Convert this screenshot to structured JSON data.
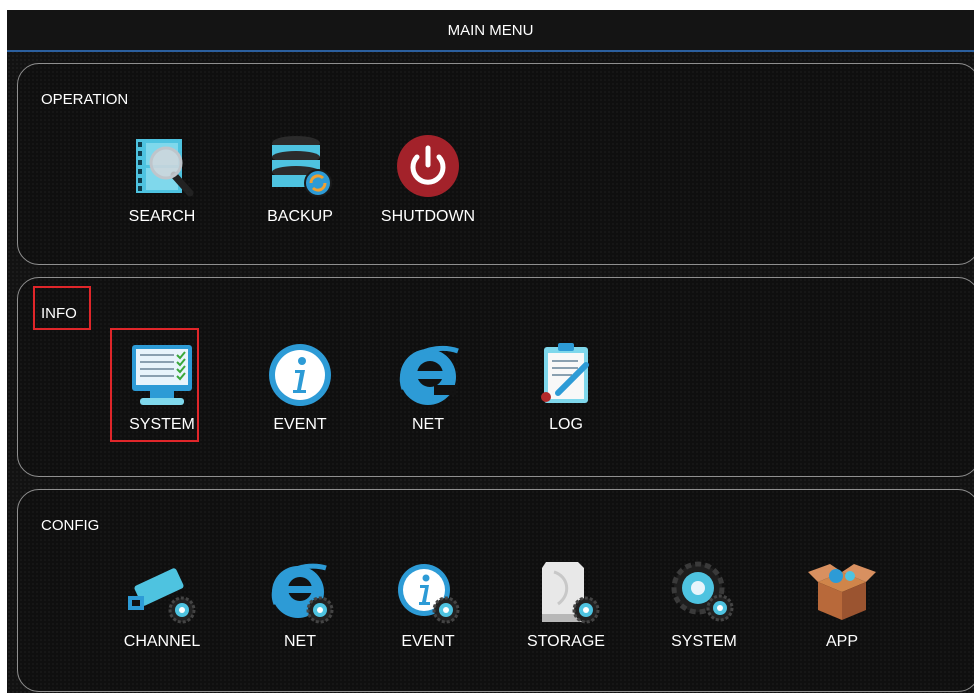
{
  "title": "MAIN MENU",
  "sections": {
    "operation": {
      "title": "OPERATION",
      "items": [
        {
          "label": "SEARCH",
          "icon": "search-icon"
        },
        {
          "label": "BACKUP",
          "icon": "backup-icon"
        },
        {
          "label": "SHUTDOWN",
          "icon": "power-icon"
        }
      ]
    },
    "info": {
      "title": "INFO",
      "items": [
        {
          "label": "SYSTEM",
          "icon": "monitor-checklist-icon"
        },
        {
          "label": "EVENT",
          "icon": "info-icon"
        },
        {
          "label": "NET",
          "icon": "internet-e-icon"
        },
        {
          "label": "LOG",
          "icon": "clipboard-log-icon"
        }
      ]
    },
    "config": {
      "title": "CONFIG",
      "items": [
        {
          "label": "CHANNEL",
          "icon": "camera-gear-icon"
        },
        {
          "label": "NET",
          "icon": "internet-e-gear-icon"
        },
        {
          "label": "EVENT",
          "icon": "info-gear-icon"
        },
        {
          "label": "STORAGE",
          "icon": "disk-gear-icon"
        },
        {
          "label": "SYSTEM",
          "icon": "system-gear-icon"
        },
        {
          "label": "APP",
          "icon": "package-icon"
        }
      ]
    }
  },
  "colors": {
    "background": "#121212",
    "panel_border": "#8f8f8f",
    "title_underline": "#2b5f9e",
    "highlight": "#e0262a",
    "icon_teal": "#4ec3e0",
    "icon_blue": "#2d9bd6",
    "power_red": "#a3222a"
  }
}
